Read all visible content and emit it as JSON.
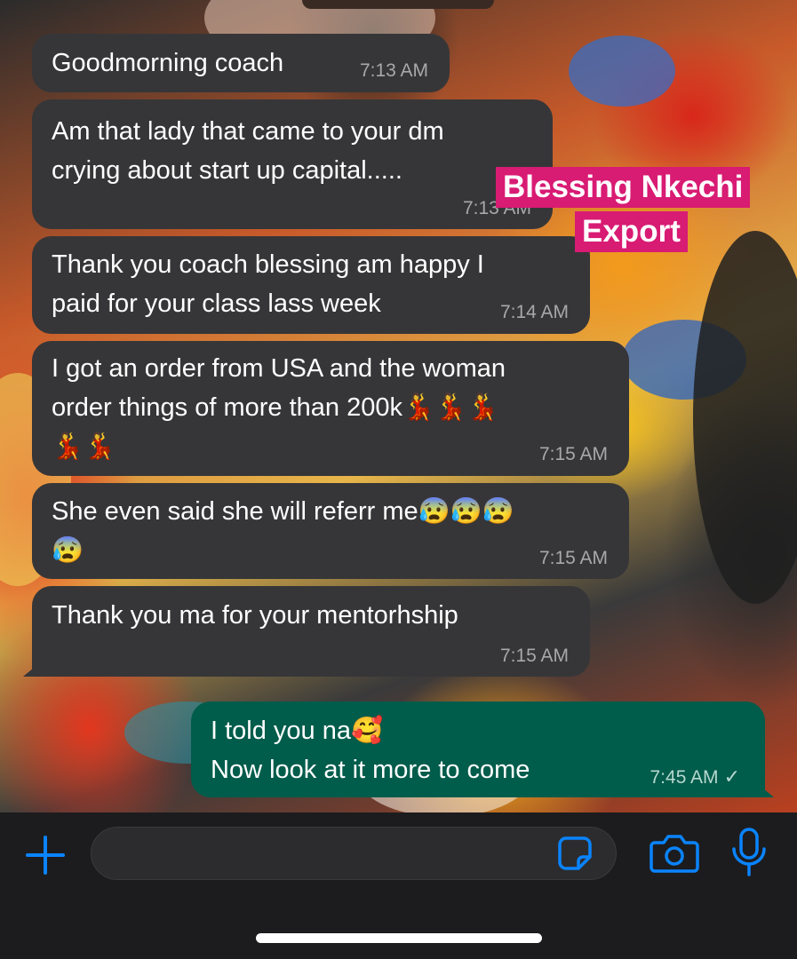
{
  "conversation": {
    "messages": [
      {
        "direction": "incoming",
        "text": "Goodmorning coach",
        "time": "7:13 AM"
      },
      {
        "direction": "incoming",
        "text": "Am that lady that came to your dm\ncrying about start up capital.....",
        "time": "7:13 AM"
      },
      {
        "direction": "incoming",
        "text": "Thank you coach blessing am happy I\npaid for your class lass week",
        "time": "7:14 AM"
      },
      {
        "direction": "incoming",
        "text": "I got an order from USA and the woman\norder things of more than 200k💃💃💃\n💃💃",
        "time": "7:15 AM"
      },
      {
        "direction": "incoming",
        "text": "She even said she will referr me😰😰😰\n😰",
        "time": "7:15 AM"
      },
      {
        "direction": "incoming",
        "text": "Thank you ma for your mentorhship",
        "time": "7:15 AM"
      },
      {
        "direction": "outgoing",
        "text": "I told you na🥰\nNow look at it more to come",
        "time": "7:45 AM",
        "status": "✓"
      }
    ]
  },
  "watermark": {
    "line1": "Blessing Nkechi",
    "line2": "Export",
    "color": "#d81b73"
  },
  "composer": {
    "placeholder": "",
    "icons": [
      "plus-icon",
      "sticker-icon",
      "camera-icon",
      "microphone-icon"
    ],
    "accent": "#0a84ff"
  },
  "colors": {
    "incoming_bubble": "#363638",
    "outgoing_bubble": "#005c4b",
    "timestamp": "#a8a8aa"
  }
}
